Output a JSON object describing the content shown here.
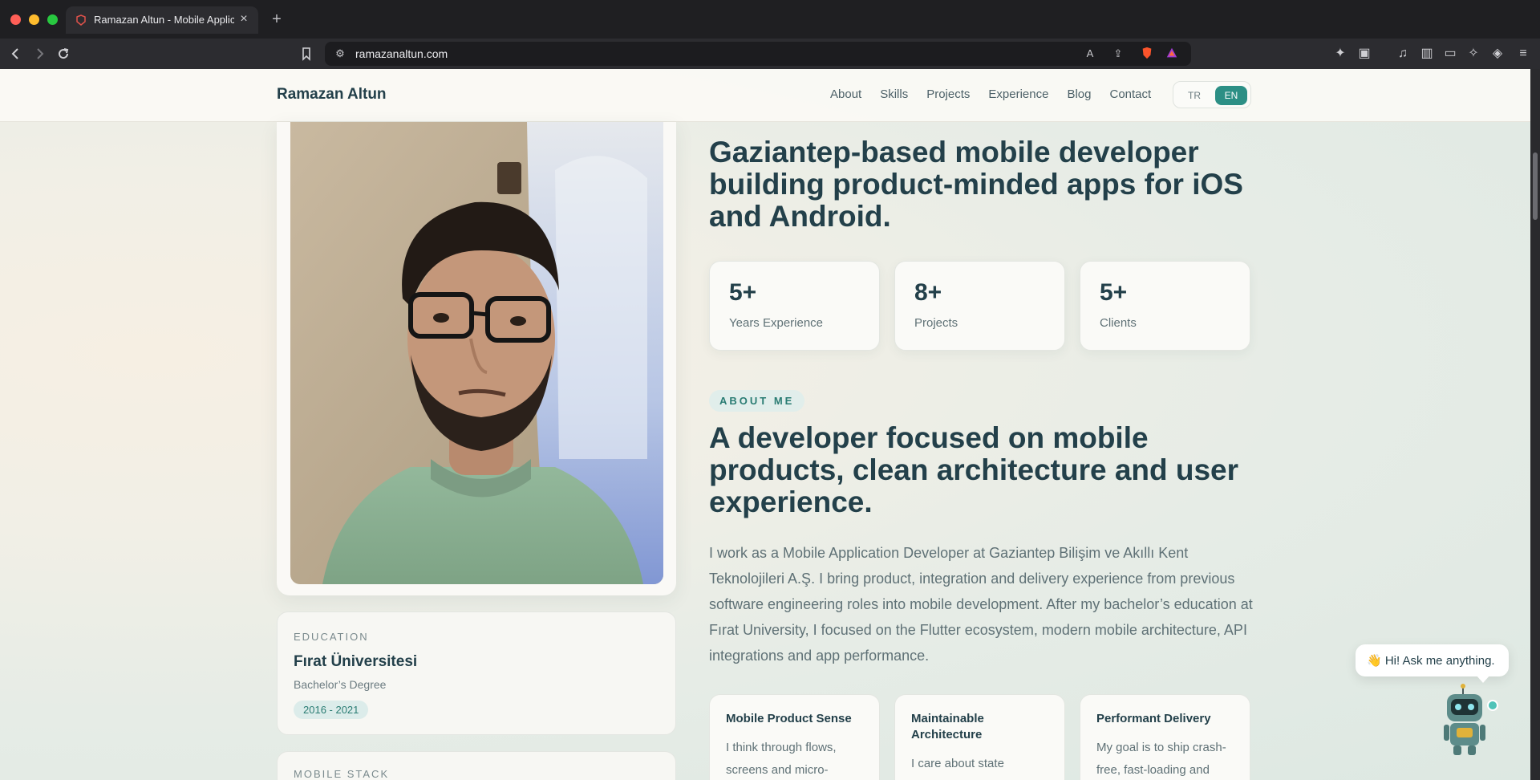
{
  "browser": {
    "tab_title": "Ramazan Altun - Mobile Application Developer",
    "url": "ramazanaltun.com"
  },
  "navbar": {
    "brand": "Ramazan Altun",
    "links": [
      "About",
      "Skills",
      "Projects",
      "Experience",
      "Blog",
      "Contact"
    ],
    "lang_options": [
      "TR",
      "EN"
    ],
    "lang_selected": "EN"
  },
  "hero": {
    "headline": "Gaziantep-based mobile developer building product-minded apps for iOS and Android."
  },
  "stats": [
    {
      "value": "5+",
      "label": "Years Experience"
    },
    {
      "value": "8+",
      "label": "Projects"
    },
    {
      "value": "5+",
      "label": "Clients"
    }
  ],
  "about": {
    "pill": "ABOUT ME",
    "title": "A developer focused on mobile products, clean architecture and user experience.",
    "body": "I work as a Mobile Application Developer at Gaziantep Bilişim ve Akıllı Kent Teknolojileri A.Ş. I bring product, integration and delivery experience from previous software engineering roles into mobile development. After my bachelor’s education at Fırat University, I focused on the Flutter ecosystem, modern mobile architecture, API integrations and app performance."
  },
  "features": [
    {
      "title": "Mobile Product Sense",
      "body": "I think through flows, screens and micro-"
    },
    {
      "title": "Maintainable Architecture",
      "body": "I care about state"
    },
    {
      "title": "Performant Delivery",
      "body": "My goal is to ship crash-free, fast-loading and"
    }
  ],
  "education": {
    "label": "EDUCATION",
    "school": "Fırat Üniversitesi",
    "degree": "Bachelor’s Degree",
    "years": "2016 - 2021"
  },
  "stack": {
    "label": "MOBILE STACK"
  },
  "chat": {
    "greeting": "👋 Hi! Ask me anything."
  },
  "colors": {
    "accent": "#2c8f85",
    "heading": "#23404a",
    "body": "#5f7176"
  }
}
